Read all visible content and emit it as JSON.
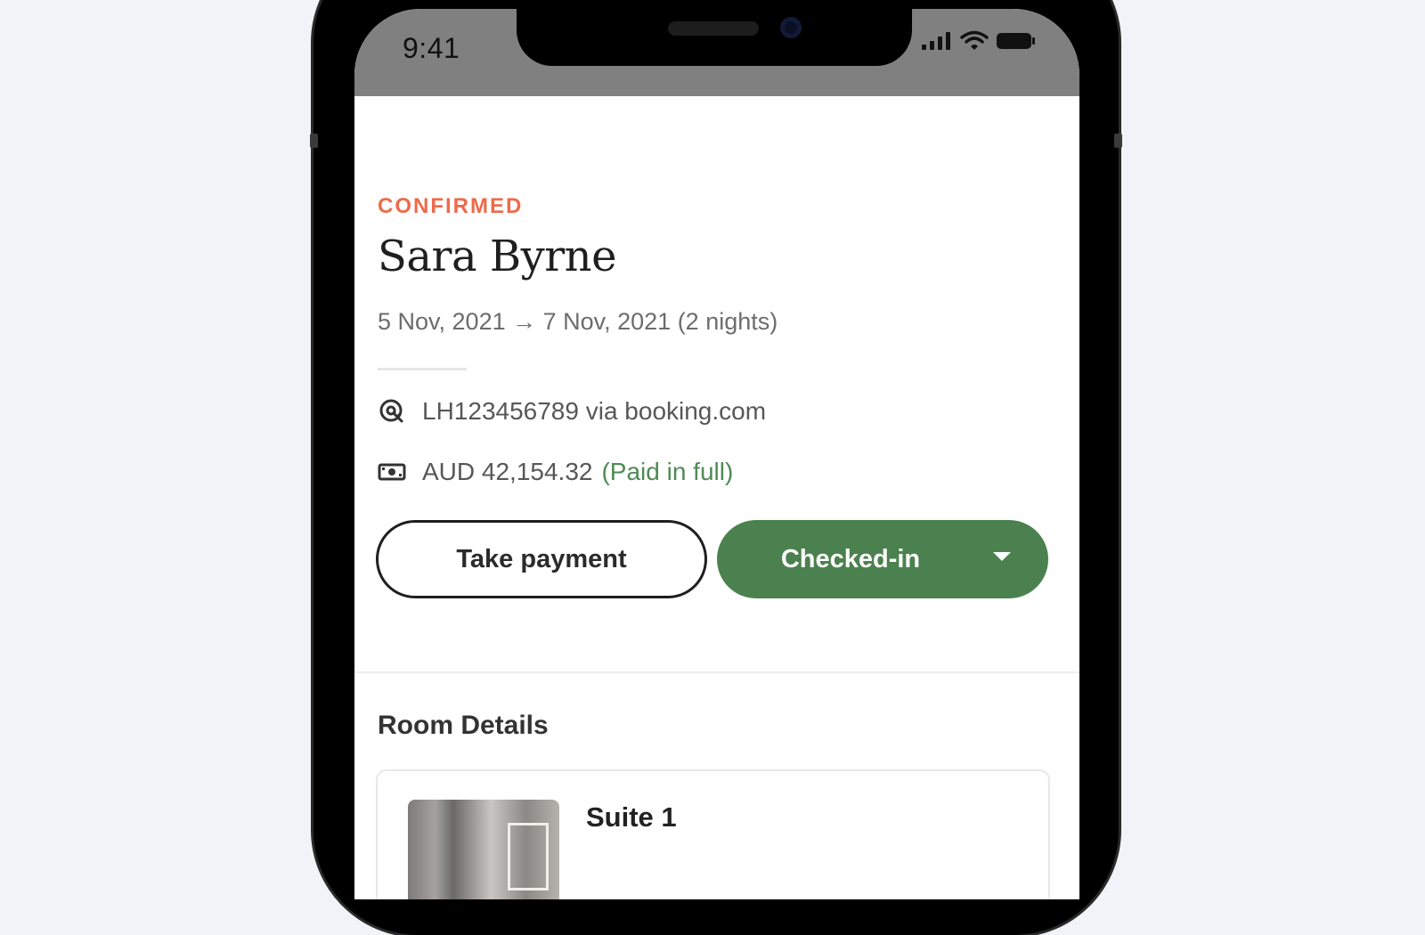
{
  "status_bar": {
    "time": "9:41",
    "icons": [
      "signal-icon",
      "wifi-icon",
      "battery-icon"
    ]
  },
  "booking": {
    "status": "CONFIRMED",
    "guest_name": "Sara Byrne",
    "dates": "5 Nov, 2021 → 7 Nov, 2021 (2 nights)",
    "reference": "LH123456789 via booking.com",
    "amount": "AUD 42,154.32",
    "payment_status": "(Paid in full)"
  },
  "actions": {
    "take_payment_label": "Take payment",
    "checkin_status_label": "Checked-in"
  },
  "room_details": {
    "title": "Room Details",
    "rooms": [
      {
        "name": "Suite 1"
      }
    ]
  },
  "colors": {
    "status_accent": "#ee6a4a",
    "primary_green": "#4b814e",
    "paid_green": "#4e8a55",
    "page_background": "#f1f3f8"
  }
}
